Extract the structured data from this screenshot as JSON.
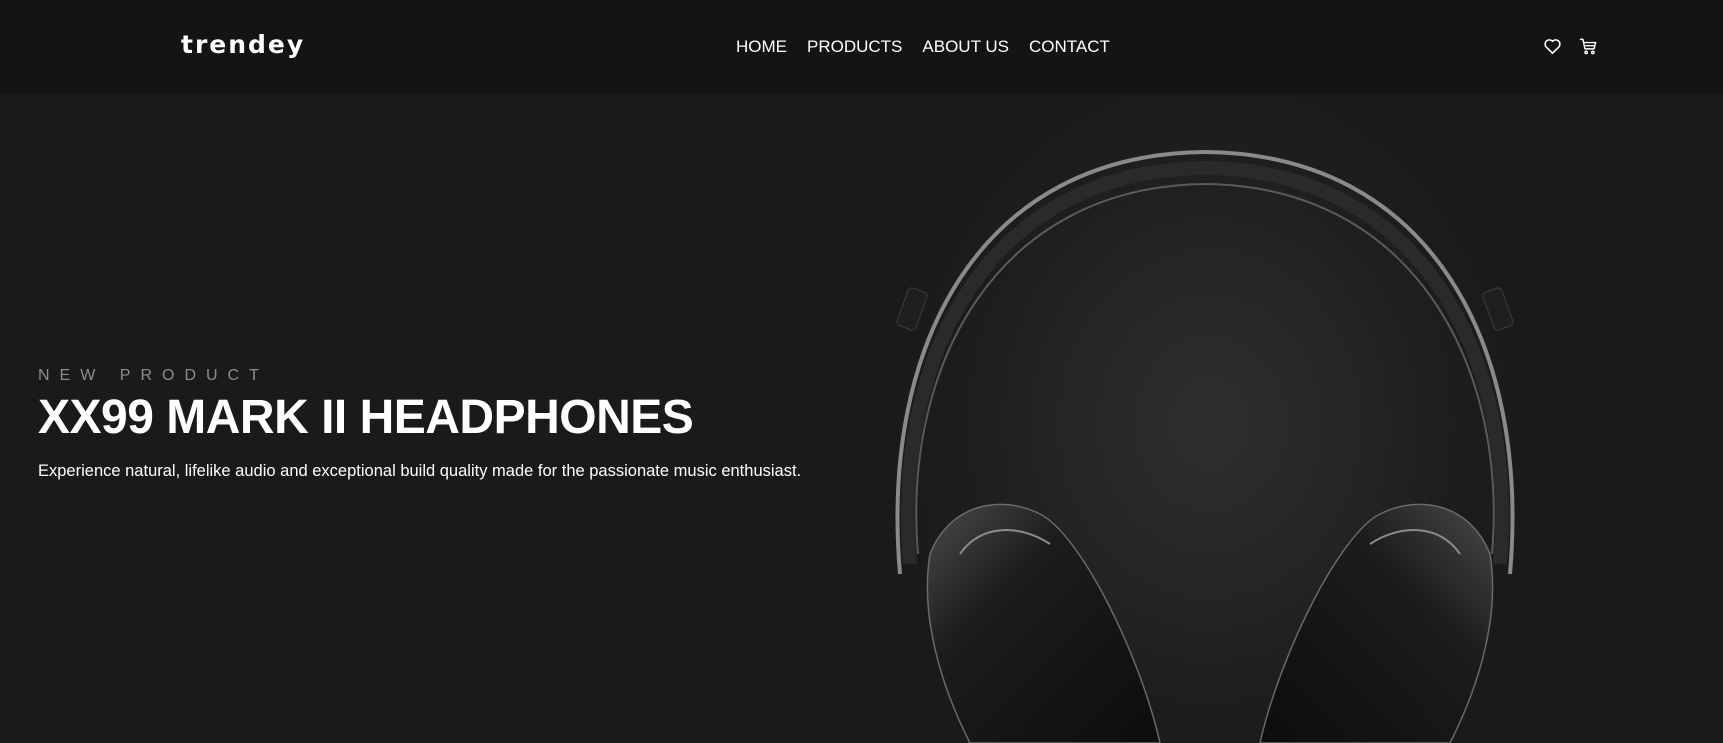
{
  "header": {
    "logo": "trendey",
    "nav": [
      {
        "label": "HOME"
      },
      {
        "label": "PRODUCTS"
      },
      {
        "label": "ABOUT US"
      },
      {
        "label": "CONTACT"
      }
    ],
    "icons": [
      "heart-icon",
      "cart-icon"
    ]
  },
  "hero": {
    "overline": "NEW PRODUCT",
    "title": "XX99 MARK II HEADPHONES",
    "description": "Experience natural, lifelike audio and exceptional build quality made for the passionate music enthusiast.",
    "image": "headphones-photo"
  },
  "colors": {
    "background": "#1a1a1b",
    "header_background": "#141414",
    "text": "#ffffff",
    "overline": "#8d8d8d"
  }
}
